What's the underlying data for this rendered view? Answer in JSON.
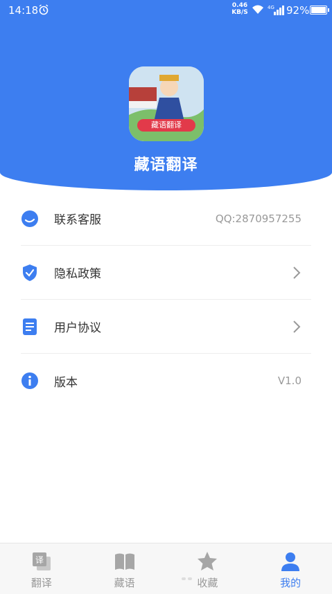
{
  "status_bar": {
    "time": "14:18",
    "net_speed_value": "0.46",
    "net_speed_unit": "KB/S",
    "battery_percent": "92%",
    "icons": [
      "alarm-icon",
      "wifi-icon",
      "signal-icon",
      "battery-icon"
    ]
  },
  "header": {
    "app_name": "藏语翻译",
    "logo_badge": "藏语翻译",
    "accent_color": "#3d7ef0"
  },
  "menu": {
    "items": [
      {
        "label": "联系客服",
        "value": "QQ:2870957255",
        "icon": "customer-service-icon"
      },
      {
        "label": "隐私政策",
        "icon": "shield-check-icon",
        "has_chevron": true
      },
      {
        "label": "用户协议",
        "icon": "document-icon",
        "has_chevron": true
      },
      {
        "label": "版本",
        "value": "V1.0",
        "icon": "info-icon"
      }
    ]
  },
  "bottom_nav": {
    "items": [
      {
        "label": "翻译",
        "icon": "translate-icon",
        "active": false
      },
      {
        "label": "藏语",
        "icon": "book-icon",
        "active": false
      },
      {
        "label": "收藏",
        "icon": "star-icon",
        "active": false
      },
      {
        "label": "我的",
        "icon": "user-icon",
        "active": true
      }
    ]
  }
}
